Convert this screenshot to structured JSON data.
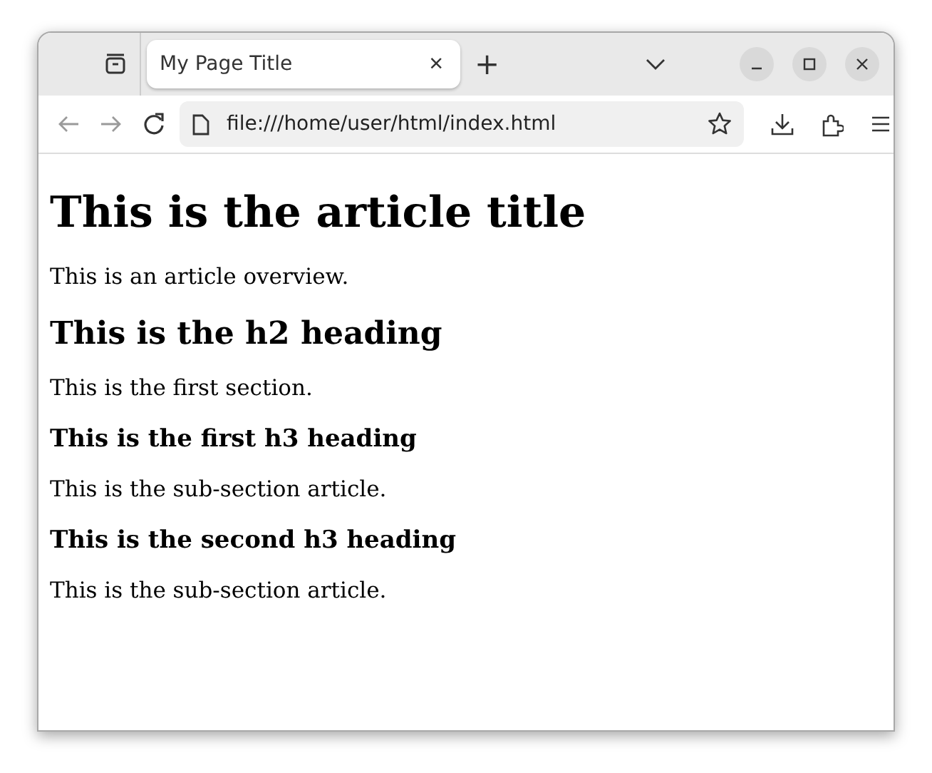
{
  "tabs": [
    {
      "title": "My Page Title",
      "close": "×",
      "selected": true
    }
  ],
  "new_tab": "+",
  "nav": [
    {
      "kind": "back",
      "disabled": true
    },
    {
      "kind": "forward",
      "disabled": true
    },
    {
      "kind": "reload",
      "disabled": false
    }
  ],
  "address": "file:///home/user/html/index.html",
  "content": [
    {
      "kind": "h1",
      "text": "This is the article title"
    },
    {
      "kind": "p",
      "text": "This is an article overview."
    },
    {
      "kind": "h2",
      "text": "This is the h2 heading"
    },
    {
      "kind": "p",
      "text": "This is the first section."
    },
    {
      "kind": "h3",
      "text": "This is the first h3 heading"
    },
    {
      "kind": "p",
      "text": "This is the sub-section article."
    },
    {
      "kind": "h3",
      "text": "This is the second h3 heading"
    },
    {
      "kind": "p",
      "text": "This is the sub-section article."
    }
  ]
}
